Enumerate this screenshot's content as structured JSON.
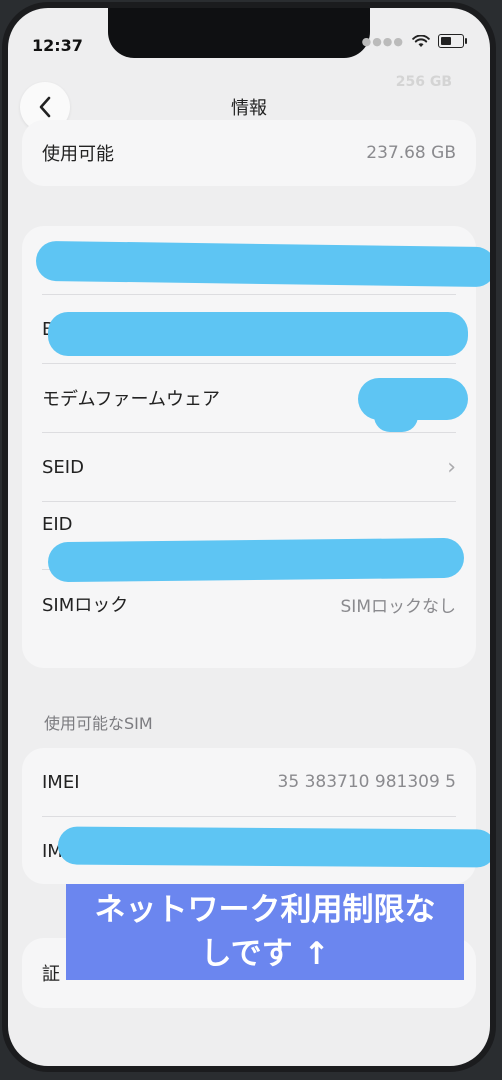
{
  "status_bar": {
    "time": "12:37"
  },
  "nav": {
    "title": "情報",
    "faded_top_value": "256 GB"
  },
  "storage_card": {
    "label": "使用可能",
    "value": "237.68 GB"
  },
  "info_card": {
    "rows": [
      {
        "label": "",
        "value": ""
      },
      {
        "label": "B",
        "value": ""
      },
      {
        "label": "モデムファームウェア",
        "value": ""
      },
      {
        "label": "SEID",
        "value": ""
      },
      {
        "label": "EID",
        "value": ""
      },
      {
        "label": "SIMロック",
        "value": "SIMロックなし"
      }
    ]
  },
  "sim_section": {
    "header": "使用可能なSIM"
  },
  "sim_card": {
    "rows": [
      {
        "label": "IMEI",
        "value": "35 383710 981309 5"
      },
      {
        "label": "IM",
        "value": ""
      }
    ]
  },
  "bottom_card": {
    "label": "証"
  },
  "overlay": {
    "line1": "ネットワーク利用制限な",
    "line2": "しです ↑",
    "colors": {
      "banner": "#6b86ef",
      "redaction": "#5ec5f3"
    }
  }
}
